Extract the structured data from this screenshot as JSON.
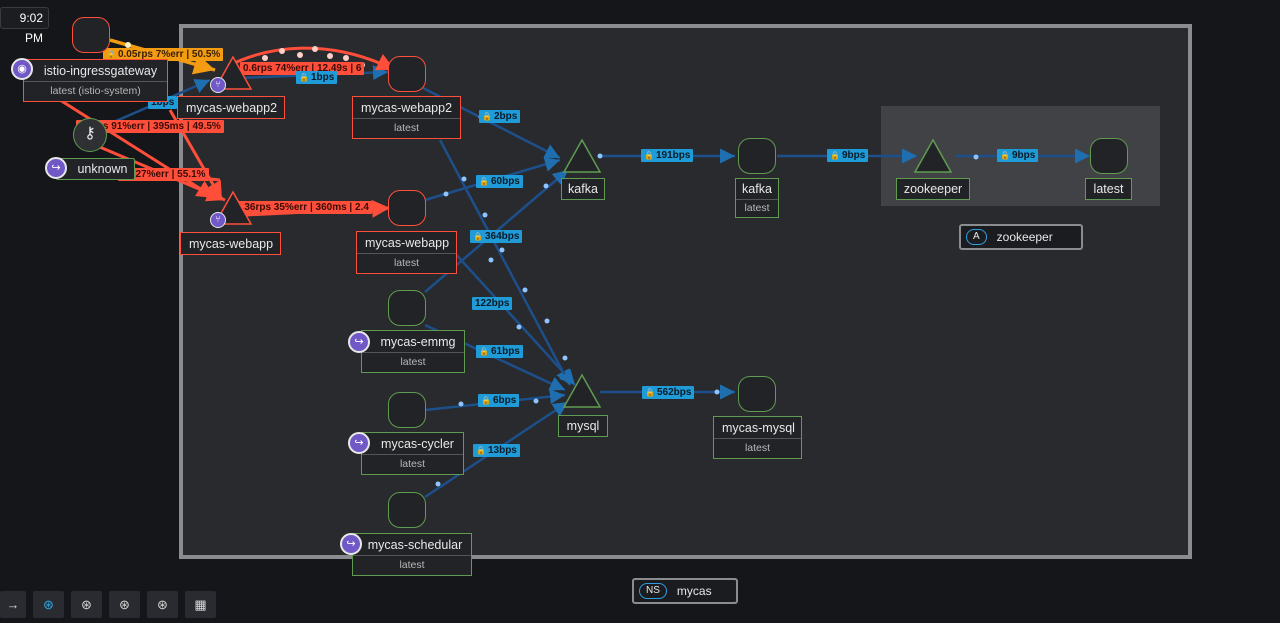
{
  "clock": {
    "time": "9:02 PM"
  },
  "namespace": {
    "tag": "NS",
    "name": "mycas"
  },
  "app_group": {
    "tag": "A",
    "name": "zookeeper"
  },
  "nodes": {
    "ingress_label": "istio-ingressgateway",
    "ingress_version": "latest (istio-system)",
    "unknown_label": "unknown",
    "webapp2_app_label": "mycas-webapp2",
    "webapp2_wl_label": "mycas-webapp2",
    "webapp2_wl_version": "latest",
    "webapp_app_label": "mycas-webapp",
    "webapp_wl_label": "mycas-webapp",
    "webapp_wl_version": "latest",
    "emmg_label": "mycas-emmg",
    "emmg_version": "latest",
    "cycler_label": "mycas-cycler",
    "cycler_version": "latest",
    "schedular_label": "mycas-schedular",
    "schedular_version": "latest",
    "kafka_svc_label": "kafka",
    "kafka_wl_label": "kafka",
    "kafka_wl_version": "latest",
    "mysql_svc_label": "mysql",
    "mysql_wl_label": "mycas-mysql",
    "mysql_wl_version": "latest",
    "zookeeper_svc_label": "zookeeper",
    "zookeeper_wl_label": "latest"
  },
  "edges": {
    "e_orange": "0.05rps 7%err | 50.5%",
    "e_top": "0.6rps 74%err | 12.49s | 6",
    "e_1bps": "1bps",
    "e_left_blue": "1bps",
    "e_red2": "0.4rps 91%err | 395ms | 49.5%",
    "e_red3": "ps 27%err | 55.1%",
    "e_red4": "0.36rps 35%err | 360ms | 2.4",
    "e_2bps": "2bps",
    "e_60bps": "60bps",
    "e_364bps": "364bps",
    "e_122bps": "122bps",
    "e_61bps": "61bps",
    "e_6bps": "6bps",
    "e_13bps": "13bps",
    "e_191bps": "191bps",
    "e_9bps_a": "9bps",
    "e_9bps_b": "9bps",
    "e_mysql": "562bps"
  },
  "toolbar": {
    "arrow": "→",
    "layout1": "⊛",
    "layout2": "⊛",
    "layout3": "⊛",
    "layout4": "⊛",
    "map": "▦"
  },
  "colors": {
    "healthy": "#5f9c51",
    "error": "#ff4f3a",
    "warning": "#f39c12",
    "traffic": "#1f9bd8",
    "namespace_border": "#8b8c90"
  }
}
